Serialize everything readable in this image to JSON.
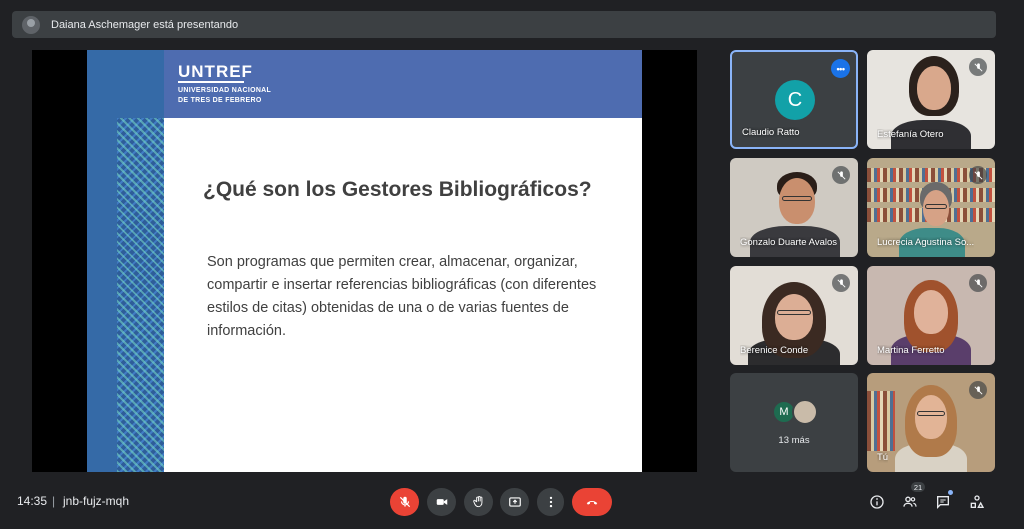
{
  "presenter": {
    "text": "Daiana Aschemager está presentando"
  },
  "slide": {
    "logo_title": "UNTREF",
    "logo_line1": "UNIVERSIDAD NACIONAL",
    "logo_line2": "DE TRES DE FEBRERO",
    "title": "¿Qué son los Gestores Bibliográficos?",
    "body": "Son programas que permiten crear, almacenar, organizar, compartir e insertar referencias bibliográficas (con diferentes estilos de citas) obtenidas de una o de varias fuentes de información."
  },
  "participants": [
    {
      "name": "Claudio Ratto",
      "initial": "C",
      "video": false,
      "active": true
    },
    {
      "name": "Estefanía Otero",
      "video": true,
      "muted": true
    },
    {
      "name": "Gonzalo Duarte Avalos",
      "video": true,
      "muted": true
    },
    {
      "name": "Lucrecia Agustina So...",
      "video": true,
      "muted": true
    },
    {
      "name": "Berenice Conde",
      "video": true,
      "muted": true
    },
    {
      "name": "Martina Ferretto",
      "video": true,
      "muted": true
    },
    {
      "name": "Tú",
      "video": true,
      "muted": true
    }
  ],
  "more": {
    "initial": "M",
    "label": "13 más"
  },
  "bottom": {
    "time": "14:35",
    "separator": "|",
    "meeting_code": "jnb-fujz-mqh",
    "people_count": "21"
  },
  "icons": {
    "mic": "mic-off-icon",
    "camera": "videocam-icon",
    "hand": "raise-hand-icon",
    "present": "present-screen-icon",
    "more": "more-vert-icon",
    "leave": "call-end-icon",
    "info": "info-icon",
    "people": "people-icon",
    "chat": "chat-icon",
    "activities": "activities-icon"
  },
  "colors": {
    "background": "#202124",
    "red": "#ea4335",
    "accent": "#8ab4f8",
    "slide_header": "#4e6cb0"
  }
}
